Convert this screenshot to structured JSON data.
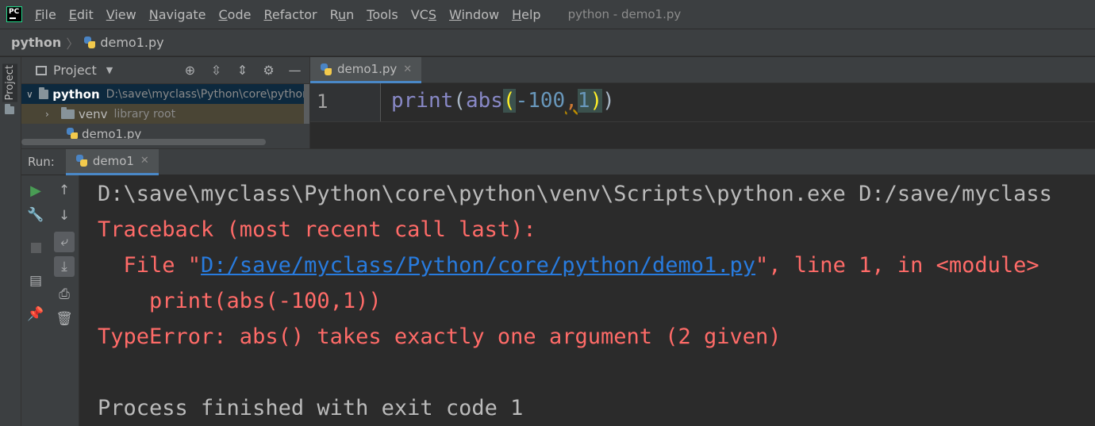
{
  "menubar": {
    "items": [
      "File",
      "Edit",
      "View",
      "Navigate",
      "Code",
      "Refactor",
      "Run",
      "Tools",
      "VCS",
      "Window",
      "Help"
    ],
    "mnemonics": [
      "F",
      "E",
      "V",
      "N",
      "C",
      "R",
      "u",
      "T",
      "S",
      "W",
      "H"
    ],
    "title": "python - demo1.py"
  },
  "breadcrumb": {
    "root": "python",
    "file": "demo1.py"
  },
  "tool_strip": {
    "project_label": "Project"
  },
  "project": {
    "header": "Project",
    "tree": [
      {
        "name": "python",
        "path": "D:\\save\\myclass\\Python\\core\\python"
      },
      {
        "name": "venv",
        "path": "library root"
      },
      {
        "name": "demo1.py"
      }
    ]
  },
  "editor": {
    "tab": "demo1.py",
    "line_number": "1",
    "code": {
      "fn1": "print",
      "p1": "(",
      "fn2": "abs",
      "p2": "(",
      "num1": "-100",
      "comma": ",",
      "num2": "1",
      "p3": ")",
      "p4": ")"
    }
  },
  "run": {
    "label": "Run:",
    "tab": "demo1",
    "console": {
      "line1": "D:\\save\\myclass\\Python\\core\\python\\venv\\Scripts\\python.exe D:/save/myclass",
      "line2": "Traceback (most recent call last):",
      "line3_prefix": "  File \"",
      "line3_link": "D:/save/myclass/Python/core/python/demo1.py",
      "line3_suffix": "\", line 1, in <module>",
      "line4": "    print(abs(-100,1))",
      "line5": "TypeError: abs() takes exactly one argument (2 given)",
      "line6": "Process finished with exit code 1"
    }
  },
  "colors": {
    "error": "#ff6b68",
    "link": "#287bde",
    "accent": "#4a88c7",
    "run_green": "#499c54"
  },
  "icons": [
    "pycharm-logo-icon",
    "python-file-icon",
    "folder-icon",
    "crosshair-icon",
    "expand-all-icon",
    "collapse-all-icon",
    "gear-icon",
    "minimize-icon",
    "play-icon",
    "wrench-icon",
    "stop-icon",
    "layout-icon",
    "pin-icon",
    "up-arrow-icon",
    "down-arrow-icon",
    "soft-wrap-icon",
    "scroll-to-end-icon",
    "print-icon",
    "trash-icon",
    "close-icon"
  ]
}
